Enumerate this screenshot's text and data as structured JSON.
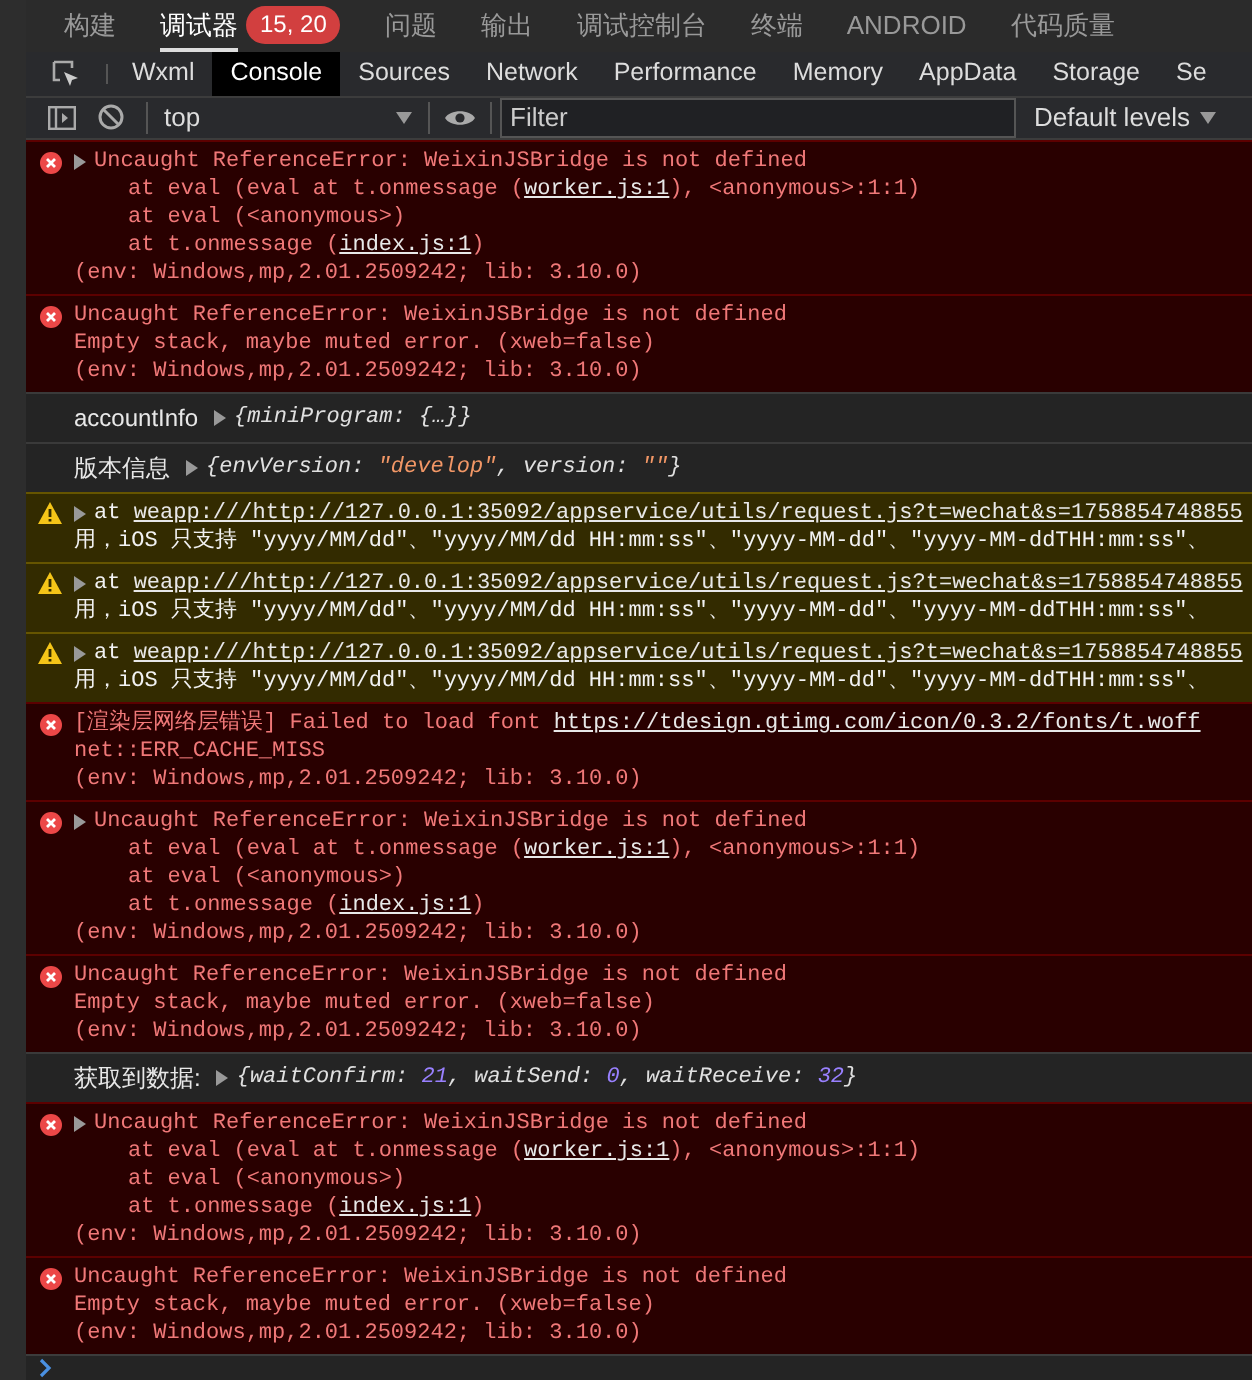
{
  "top_tabs": [
    {
      "label": "构建",
      "selected": false
    },
    {
      "label": "调试器",
      "selected": true,
      "badge": "15, 20"
    },
    {
      "label": "问题",
      "selected": false
    },
    {
      "label": "输出",
      "selected": false
    },
    {
      "label": "调试控制台",
      "selected": false
    },
    {
      "label": "终端",
      "selected": false
    },
    {
      "label": "ANDROID",
      "selected": false
    },
    {
      "label": "代码质量",
      "selected": false
    }
  ],
  "devtools_tabs": [
    {
      "label": "Wxml",
      "selected": false
    },
    {
      "label": "Console",
      "selected": true
    },
    {
      "label": "Sources",
      "selected": false
    },
    {
      "label": "Network",
      "selected": false
    },
    {
      "label": "Performance",
      "selected": false
    },
    {
      "label": "Memory",
      "selected": false
    },
    {
      "label": "AppData",
      "selected": false
    },
    {
      "label": "Storage",
      "selected": false
    },
    {
      "label": "Se",
      "selected": false
    }
  ],
  "toolbar": {
    "context": "top",
    "filter": {
      "placeholder": "Filter"
    },
    "levels": "Default levels"
  },
  "messages": [
    {
      "kind": "error",
      "expandable": true,
      "lines": [
        {
          "kind": "message",
          "text": "Uncaught ReferenceError: WeixinJSBridge is not defined"
        },
        {
          "kind": "stack",
          "text": "at eval (eval at t.onmessage (",
          "link": "worker.js:1",
          "after": "), <anonymous>:1:1)"
        },
        {
          "kind": "stack",
          "text": "at eval (<anonymous>)"
        },
        {
          "kind": "stack",
          "text": "at t.onmessage (",
          "link": "index.js:1",
          "after": ")"
        },
        {
          "kind": "plain",
          "text": "(env: Windows,mp,2.01.2509242; lib: 3.10.0)"
        }
      ]
    },
    {
      "kind": "error",
      "expandable": false,
      "lines": [
        {
          "kind": "message",
          "text": "Uncaught ReferenceError: WeixinJSBridge is not defined"
        },
        {
          "kind": "plain",
          "text": "Empty stack, maybe muted error. (xweb=false)"
        },
        {
          "kind": "plain",
          "text": "(env: Windows,mp,2.01.2509242; lib: 3.10.0)"
        }
      ]
    },
    {
      "kind": "log",
      "label": "accountInfo",
      "preview": [
        {
          "kind": "plain",
          "text": "{miniProgram: {…}}"
        }
      ]
    },
    {
      "kind": "log",
      "label": "版本信息",
      "preview": [
        {
          "kind": "plain",
          "text": "{envVersion: "
        },
        {
          "kind": "string",
          "text": "\"develop\""
        },
        {
          "kind": "plain",
          "text": ", version: "
        },
        {
          "kind": "string",
          "text": "\"\""
        },
        {
          "kind": "plain",
          "text": "}"
        }
      ]
    },
    {
      "kind": "warning",
      "expandable": true,
      "lines": [
        {
          "kind": "message",
          "text": "at ",
          "link": "weapp:///http://127.0.0.1:35092/appservice/utils/request.js?t=wechat&s=1758854748855"
        },
        {
          "kind": "plain",
          "text": "用，iOS 只支持 \"yyyy/MM/dd\"、\"yyyy/MM/dd HH:mm:ss\"、\"yyyy-MM-dd\"、\"yyyy-MM-ddTHH:mm:ss\"、"
        }
      ]
    },
    {
      "kind": "warning",
      "expandable": true,
      "lines": [
        {
          "kind": "message",
          "text": "at ",
          "link": "weapp:///http://127.0.0.1:35092/appservice/utils/request.js?t=wechat&s=1758854748855"
        },
        {
          "kind": "plain",
          "text": "用，iOS 只支持 \"yyyy/MM/dd\"、\"yyyy/MM/dd HH:mm:ss\"、\"yyyy-MM-dd\"、\"yyyy-MM-ddTHH:mm:ss\"、"
        }
      ]
    },
    {
      "kind": "warning",
      "expandable": true,
      "lines": [
        {
          "kind": "message",
          "text": "at ",
          "link": "weapp:///http://127.0.0.1:35092/appservice/utils/request.js?t=wechat&s=1758854748855"
        },
        {
          "kind": "plain",
          "text": "用，iOS 只支持 \"yyyy/MM/dd\"、\"yyyy/MM/dd HH:mm:ss\"、\"yyyy-MM-dd\"、\"yyyy-MM-ddTHH:mm:ss\"、"
        }
      ]
    },
    {
      "kind": "error",
      "expandable": false,
      "lines": [
        {
          "kind": "plain",
          "text": "[渲染层网络层错误] Failed to load font ",
          "link": "https://tdesign.gtimg.com/icon/0.3.2/fonts/t.woff"
        },
        {
          "kind": "plain",
          "text": "net::ERR_CACHE_MISS"
        },
        {
          "kind": "plain",
          "text": "(env: Windows,mp,2.01.2509242; lib: 3.10.0)"
        }
      ]
    },
    {
      "kind": "error",
      "expandable": true,
      "lines": [
        {
          "kind": "message",
          "text": "Uncaught ReferenceError: WeixinJSBridge is not defined"
        },
        {
          "kind": "stack",
          "text": "at eval (eval at t.onmessage (",
          "link": "worker.js:1",
          "after": "), <anonymous>:1:1)"
        },
        {
          "kind": "stack",
          "text": "at eval (<anonymous>)"
        },
        {
          "kind": "stack",
          "text": "at t.onmessage (",
          "link": "index.js:1",
          "after": ")"
        },
        {
          "kind": "plain",
          "text": "(env: Windows,mp,2.01.2509242; lib: 3.10.0)"
        }
      ]
    },
    {
      "kind": "error",
      "expandable": false,
      "lines": [
        {
          "kind": "message",
          "text": "Uncaught ReferenceError: WeixinJSBridge is not defined"
        },
        {
          "kind": "plain",
          "text": "Empty stack, maybe muted error. (xweb=false)"
        },
        {
          "kind": "plain",
          "text": "(env: Windows,mp,2.01.2509242; lib: 3.10.0)"
        }
      ]
    },
    {
      "kind": "log",
      "label": "获取到数据:",
      "preview": [
        {
          "kind": "plain",
          "text": "{waitConfirm: "
        },
        {
          "kind": "number",
          "text": "21"
        },
        {
          "kind": "plain",
          "text": ", waitSend: "
        },
        {
          "kind": "number",
          "text": "0"
        },
        {
          "kind": "plain",
          "text": ", waitReceive: "
        },
        {
          "kind": "number",
          "text": "32"
        },
        {
          "kind": "plain",
          "text": "}"
        }
      ]
    },
    {
      "kind": "error",
      "expandable": true,
      "lines": [
        {
          "kind": "message",
          "text": "Uncaught ReferenceError: WeixinJSBridge is not defined"
        },
        {
          "kind": "stack",
          "text": "at eval (eval at t.onmessage (",
          "link": "worker.js:1",
          "after": "), <anonymous>:1:1)"
        },
        {
          "kind": "stack",
          "text": "at eval (<anonymous>)"
        },
        {
          "kind": "stack",
          "text": "at t.onmessage (",
          "link": "index.js:1",
          "after": ")"
        },
        {
          "kind": "plain",
          "text": "(env: Windows,mp,2.01.2509242; lib: 3.10.0)"
        }
      ]
    },
    {
      "kind": "error",
      "expandable": false,
      "lines": [
        {
          "kind": "message",
          "text": "Uncaught ReferenceError: WeixinJSBridge is not defined"
        },
        {
          "kind": "plain",
          "text": "Empty stack, maybe muted error. (xweb=false)"
        },
        {
          "kind": "plain",
          "text": "(env: Windows,mp,2.01.2509242; lib: 3.10.0)"
        }
      ]
    }
  ]
}
